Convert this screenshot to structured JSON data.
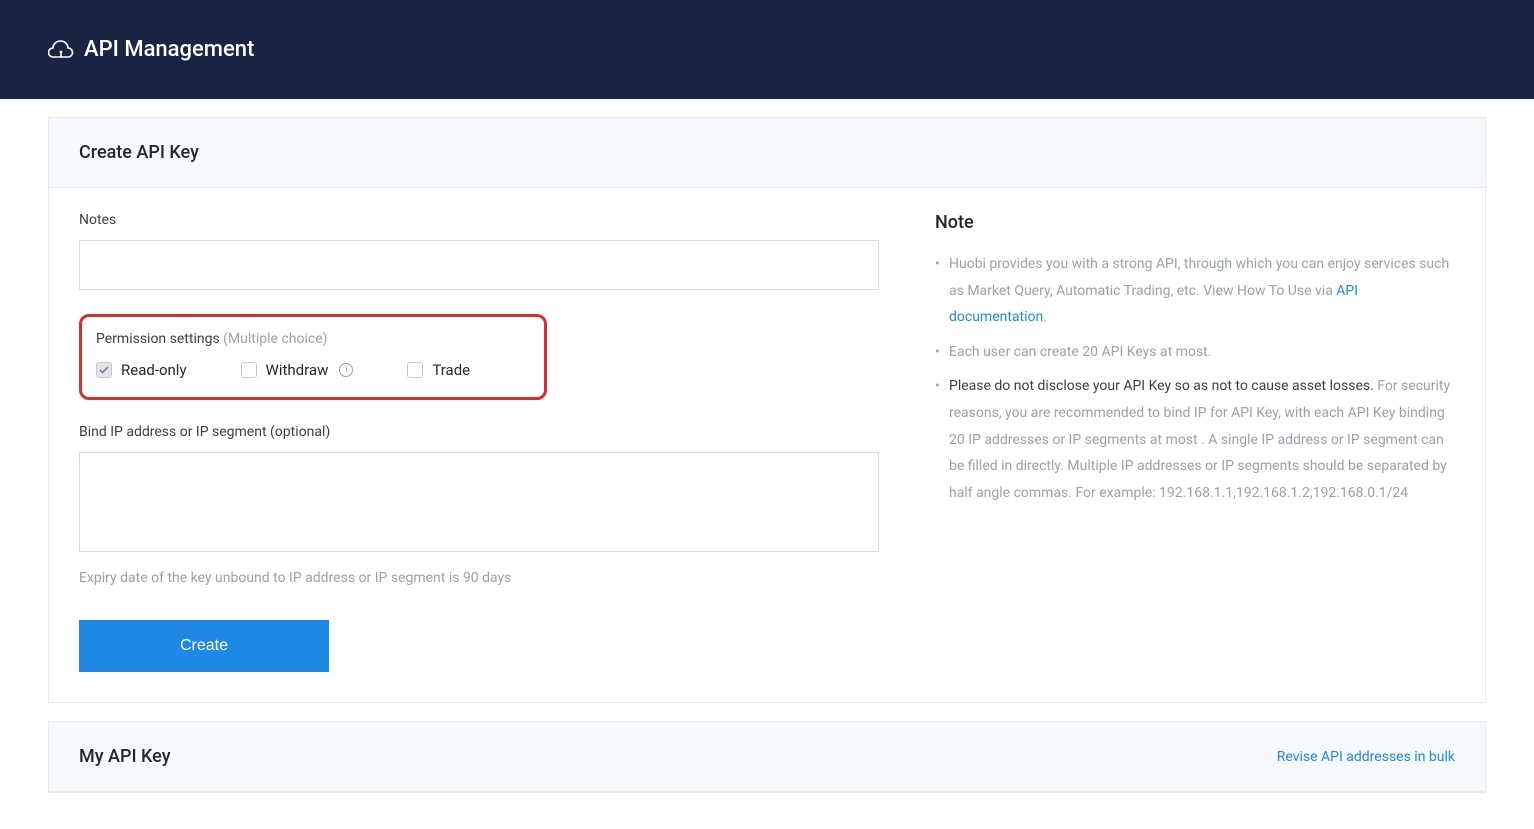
{
  "header": {
    "title": "API Management"
  },
  "create": {
    "title": "Create API Key",
    "notesLabel": "Notes",
    "notesValue": "",
    "permLabel": "Permission settings",
    "permHint": "(Multiple choice)",
    "permissions": [
      {
        "label": "Read-only",
        "checked": true
      },
      {
        "label": "Withdraw",
        "checked": false,
        "info": true
      },
      {
        "label": "Trade",
        "checked": false
      }
    ],
    "ipLabel": "Bind IP address or IP segment (optional)",
    "ipValue": "",
    "expiryHint": "Expiry date of the key unbound to IP address or IP segment is 90 days",
    "createBtn": "Create"
  },
  "note": {
    "title": "Note",
    "item1_a": "Huobi provides you with a strong API, through which you can enjoy services such as Market Query, Automatic Trading, etc. View How To Use via ",
    "item1_link": "API documentation",
    "item1_b": ".",
    "item2": "Each user can create 20 API Keys at most.",
    "item3_a": "Please do not disclose your API Key so as not to cause asset losses.",
    "item3_b": " For security reasons, you are recommended to bind IP for API Key, with each API Key binding 20 IP addresses or IP segments at most . A single IP address or IP segment can be filled in directly. Multiple IP addresses or IP segments should be separated by half angle commas. For example: 192.168.1.1,192.168.1.2,192.168.0.1/24"
  },
  "myKeys": {
    "title": "My API Key",
    "reviseLink": "Revise API addresses in bulk"
  }
}
